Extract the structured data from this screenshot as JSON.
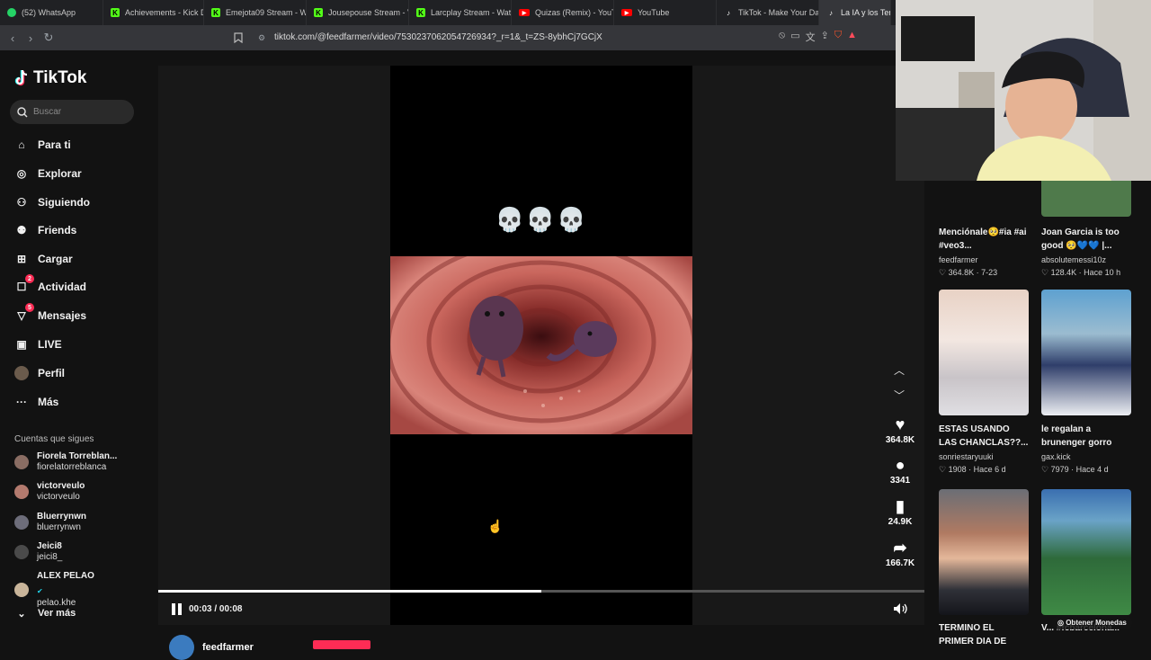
{
  "browser": {
    "tabs": [
      {
        "label": "(52) WhatsApp",
        "icon": "whatsapp-icon",
        "color": "#25d366"
      },
      {
        "label": "Achievements - Kick D",
        "icon": "kick-icon",
        "color": "#53fc18"
      },
      {
        "label": "Emejota09 Stream - W",
        "icon": "kick-icon",
        "color": "#53fc18"
      },
      {
        "label": "Jousepouse Stream - V",
        "icon": "kick-icon",
        "color": "#53fc18"
      },
      {
        "label": "Larcplay Stream - Wat",
        "icon": "kick-icon",
        "color": "#53fc18"
      },
      {
        "label": "Quizas (Remix) - YouTu",
        "icon": "youtube-icon",
        "color": "#ff0000"
      },
      {
        "label": "YouTube",
        "icon": "youtube-icon",
        "color": "#ff0000"
      },
      {
        "label": "TikTok - Make Your Da",
        "icon": "tiktok-icon",
        "color": "#ffffff"
      },
      {
        "label": "La IA y los Ter",
        "icon": "tiktok-icon",
        "color": "#ffffff"
      }
    ],
    "url": "tiktok.com/@feedfarmer/video/7530237062054726934?_r=1&_t=ZS-8ybhCj7GCjX"
  },
  "sidebar": {
    "logo": "TikTok",
    "search_placeholder": "Buscar",
    "nav": [
      {
        "label": "Para ti",
        "icon": "home-icon"
      },
      {
        "label": "Explorar",
        "icon": "compass-icon"
      },
      {
        "label": "Siguiendo",
        "icon": "following-icon"
      },
      {
        "label": "Friends",
        "icon": "friends-icon"
      },
      {
        "label": "Cargar",
        "icon": "upload-icon"
      },
      {
        "label": "Actividad",
        "icon": "activity-icon",
        "badge": "2"
      },
      {
        "label": "Mensajes",
        "icon": "messages-icon",
        "badge": "5"
      },
      {
        "label": "LIVE",
        "icon": "live-icon"
      },
      {
        "label": "Perfil",
        "icon": "profile-icon"
      },
      {
        "label": "Más",
        "icon": "more-icon"
      }
    ],
    "following_title": "Cuentas que sigues",
    "following": [
      {
        "name": "Fiorela Torreblan...",
        "handle": "fiorelatorreblanca"
      },
      {
        "name": "victorveulo",
        "handle": "victorveulo"
      },
      {
        "name": "Bluerrynwn",
        "handle": "bluerrynwn"
      },
      {
        "name": "Jeici8",
        "handle": "jeici8_"
      },
      {
        "name": "ALEX PELAO",
        "handle": "pelao.khe",
        "verified": true
      }
    ],
    "see_more": "Ver más"
  },
  "player": {
    "caption_emoji": "💀💀💀",
    "time": "00:03 / 00:08",
    "progress": 0.5,
    "author": "feedfarmer",
    "actions": [
      {
        "icon": "heart-icon",
        "count": "364.8K"
      },
      {
        "icon": "comment-icon",
        "count": "3341"
      },
      {
        "icon": "bookmark-icon",
        "count": "24.9K"
      },
      {
        "icon": "share-icon",
        "count": "166.7K"
      }
    ]
  },
  "related": [
    {
      "title": "Menciónale🥺#ia #ai #veo3...",
      "user": "feedfarmer",
      "likes": "364.8K",
      "date": "7-23"
    },
    {
      "title": "Joan Garcia is too good 🥺💙💙 |...",
      "user": "absolutemessi10z",
      "likes": "128.4K",
      "date": "Hace 10 h"
    },
    {
      "title": "ESTAS USANDO LAS CHANCLAS??...",
      "user": "sonriestaryuuki",
      "likes": "1908",
      "date": "Hace 6 d"
    },
    {
      "title": "le regalan a brunenger gorro de...",
      "user": "gax.kick",
      "likes": "7979",
      "date": "Hace 4 d"
    },
    {
      "title": "TERMINO EL PRIMER DIA DE FNCS FINALS",
      "user": "",
      "likes": "",
      "date": ""
    },
    {
      "title": "V... #fcbarcelona...",
      "user": "",
      "likes": "",
      "date": ""
    }
  ],
  "coins_button": "Obtener Monedas",
  "colors": {
    "accent": "#fe2c55",
    "bg": "#121212"
  }
}
